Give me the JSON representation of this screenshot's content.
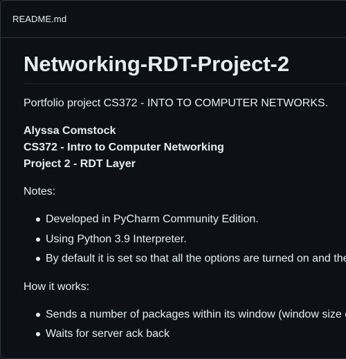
{
  "file": {
    "name": "README.md"
  },
  "readme": {
    "title": "Networking-RDT-Project-2",
    "intro": "Portfolio project CS372 - INTO TO COMPUTER NETWORKS.",
    "author_lines": [
      "Alyssa Comstock",
      "CS372 - Intro to Computer Networking",
      "Project 2 - RDT Layer"
    ],
    "notes_heading": "Notes:",
    "notes": [
      "Developed in PyCharm Community Edition.",
      "Using Python 3.9 Interpreter.",
      "By default it is set so that all the options are turned on and the"
    ],
    "how_heading": "How it works:",
    "how_items": [
      "Sends a number of packages within its window (window size c",
      "Waits for server ack back"
    ]
  },
  "colors": {
    "background": "#0d1117",
    "text": "#e6edf3",
    "border": "#30363d"
  }
}
